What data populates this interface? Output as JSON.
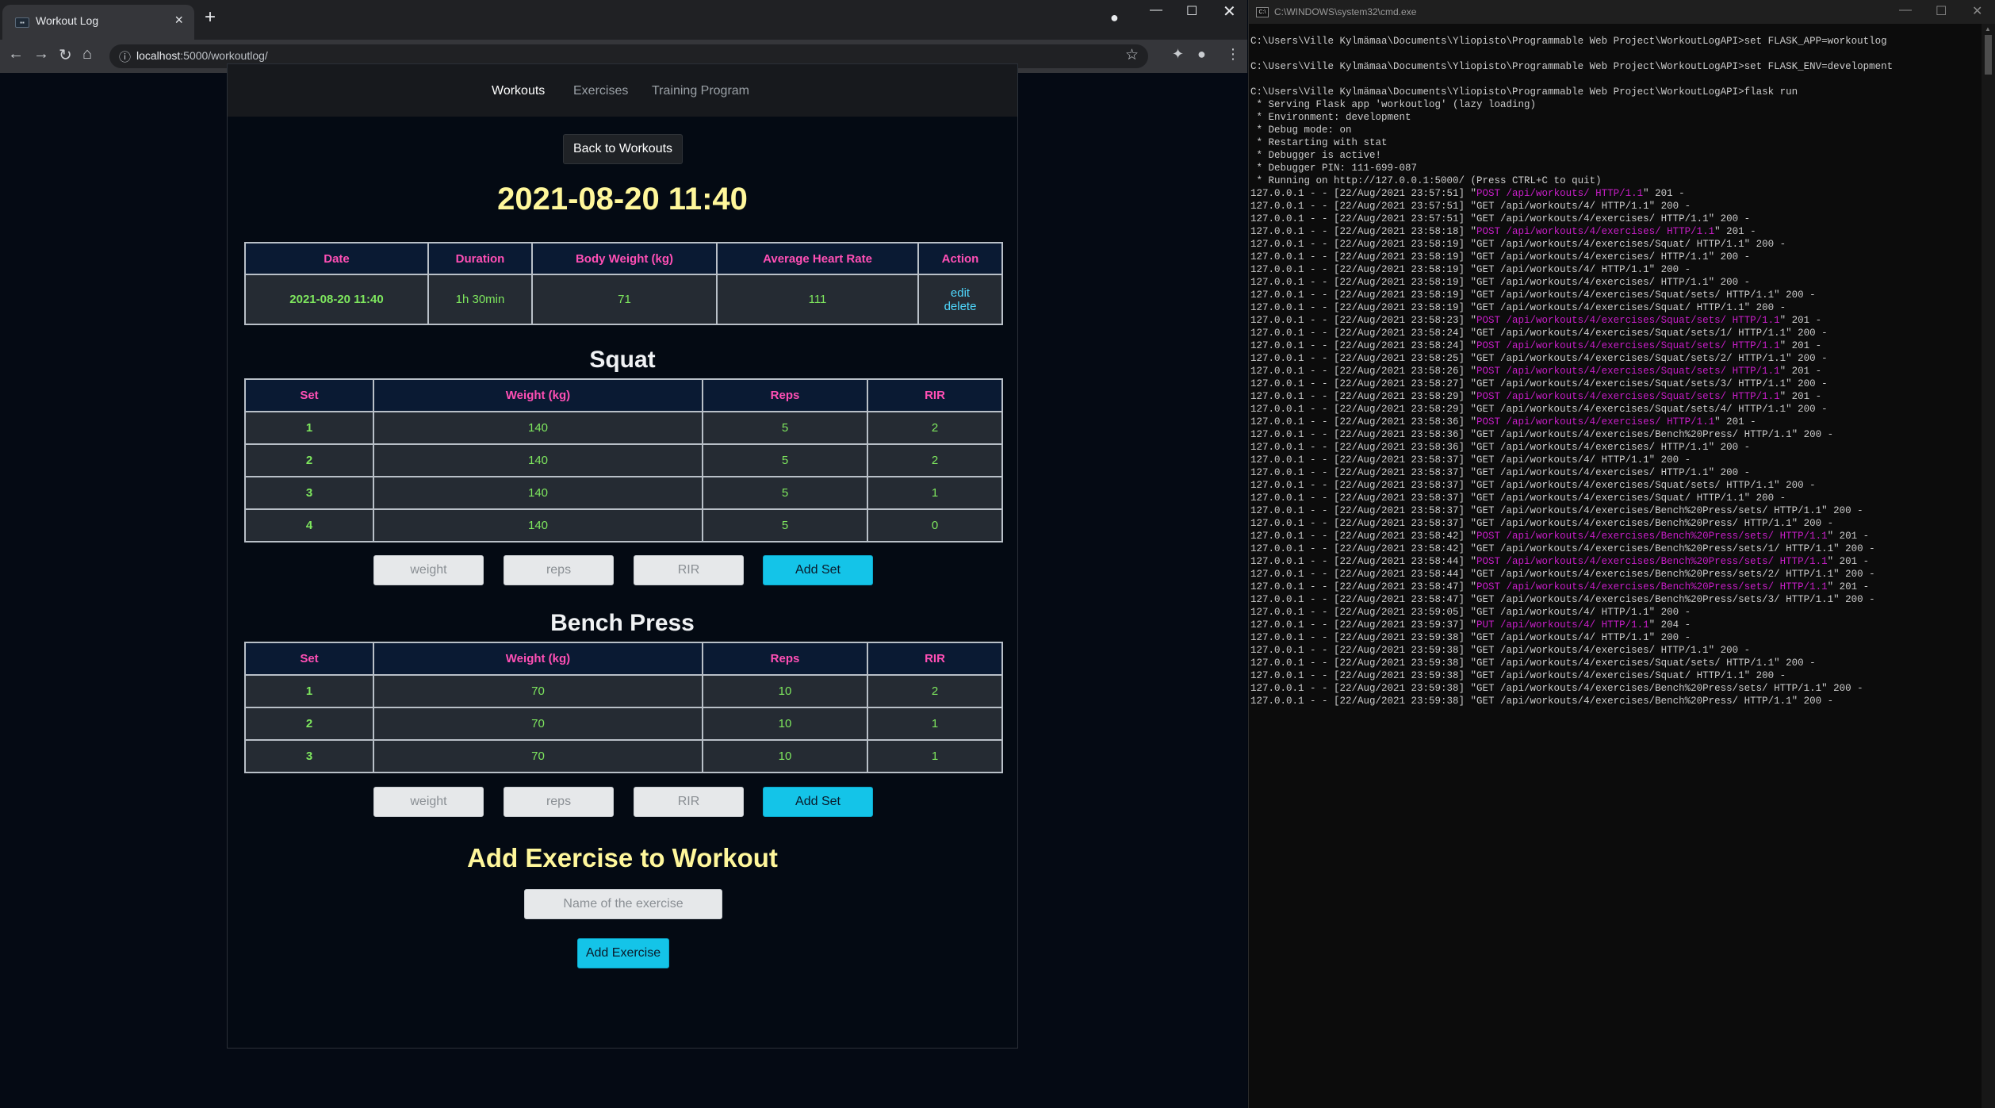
{
  "browser": {
    "tab_title": "Workout Log",
    "url_host": "localhost",
    "url_rest": ":5000/workoutlog/"
  },
  "nav": {
    "workouts": "Workouts",
    "exercises": "Exercises",
    "training_program": "Training Program"
  },
  "back_button": "Back to Workouts",
  "workout": {
    "date_title": "2021-08-20 11:40",
    "headers": [
      "Date",
      "Duration",
      "Body Weight (kg)",
      "Average Heart Rate",
      "Action"
    ],
    "row": [
      "2021-08-20 11:40",
      "1h 30min",
      "71",
      "111"
    ],
    "actions": {
      "edit": "edit",
      "delete": "delete"
    }
  },
  "set_headers": [
    "Set",
    "Weight (kg)",
    "Reps",
    "RIR"
  ],
  "exercises": [
    {
      "name": "Squat",
      "sets": [
        [
          "1",
          "140",
          "5",
          "2"
        ],
        [
          "2",
          "140",
          "5",
          "2"
        ],
        [
          "3",
          "140",
          "5",
          "1"
        ],
        [
          "4",
          "140",
          "5",
          "0"
        ]
      ]
    },
    {
      "name": "Bench Press",
      "sets": [
        [
          "1",
          "70",
          "10",
          "2"
        ],
        [
          "2",
          "70",
          "10",
          "1"
        ],
        [
          "3",
          "70",
          "10",
          "1"
        ]
      ]
    }
  ],
  "set_form": {
    "weight_placeholder": "weight",
    "reps_placeholder": "reps",
    "rir_placeholder": "RIR",
    "add_label": "Add Set"
  },
  "add_exercise": {
    "title": "Add Exercise to Workout",
    "placeholder": "Name of the exercise",
    "button": "Add Exercise"
  },
  "terminal": {
    "title": "C:\\WINDOWS\\system32\\cmd.exe",
    "lines": [
      {
        "t": "C:\\Users\\Ville Kylmämaa\\Documents\\Yliopisto\\Programmable Web Project\\WorkoutLogAPI>set FLASK_APP=workoutlog"
      },
      {
        "t": ""
      },
      {
        "t": "C:\\Users\\Ville Kylmämaa\\Documents\\Yliopisto\\Programmable Web Project\\WorkoutLogAPI>set FLASK_ENV=development"
      },
      {
        "t": ""
      },
      {
        "t": "C:\\Users\\Ville Kylmämaa\\Documents\\Yliopisto\\Programmable Web Project\\WorkoutLogAPI>flask run"
      },
      {
        "t": " * Serving Flask app 'workoutlog' (lazy loading)"
      },
      {
        "t": " * Environment: development"
      },
      {
        "t": " * Debug mode: on"
      },
      {
        "t": " * Restarting with stat"
      },
      {
        "t": " * Debugger is active!"
      },
      {
        "t": " * Debugger PIN: 111-699-087"
      },
      {
        "t": " * Running on http://127.0.0.1:5000/ (Press CTRL+C to quit)"
      },
      {
        "p": "127.0.0.1 - - [22/Aug/2021 23:57:51] \"",
        "h": "POST /api/workouts/ HTTP/1.1",
        "s": "\" 201 -"
      },
      {
        "t": "127.0.0.1 - - [22/Aug/2021 23:57:51] \"GET /api/workouts/4/ HTTP/1.1\" 200 -"
      },
      {
        "t": "127.0.0.1 - - [22/Aug/2021 23:57:51] \"GET /api/workouts/4/exercises/ HTTP/1.1\" 200 -"
      },
      {
        "p": "127.0.0.1 - - [22/Aug/2021 23:58:18] \"",
        "h": "POST /api/workouts/4/exercises/ HTTP/1.1",
        "s": "\" 201 -"
      },
      {
        "t": "127.0.0.1 - - [22/Aug/2021 23:58:19] \"GET /api/workouts/4/exercises/Squat/ HTTP/1.1\" 200 -"
      },
      {
        "t": "127.0.0.1 - - [22/Aug/2021 23:58:19] \"GET /api/workouts/4/exercises/ HTTP/1.1\" 200 -"
      },
      {
        "t": "127.0.0.1 - - [22/Aug/2021 23:58:19] \"GET /api/workouts/4/ HTTP/1.1\" 200 -"
      },
      {
        "t": "127.0.0.1 - - [22/Aug/2021 23:58:19] \"GET /api/workouts/4/exercises/ HTTP/1.1\" 200 -"
      },
      {
        "t": "127.0.0.1 - - [22/Aug/2021 23:58:19] \"GET /api/workouts/4/exercises/Squat/sets/ HTTP/1.1\" 200 -"
      },
      {
        "t": "127.0.0.1 - - [22/Aug/2021 23:58:19] \"GET /api/workouts/4/exercises/Squat/ HTTP/1.1\" 200 -"
      },
      {
        "p": "127.0.0.1 - - [22/Aug/2021 23:58:23] \"",
        "h": "POST /api/workouts/4/exercises/Squat/sets/ HTTP/1.1",
        "s": "\" 201 -"
      },
      {
        "t": "127.0.0.1 - - [22/Aug/2021 23:58:24] \"GET /api/workouts/4/exercises/Squat/sets/1/ HTTP/1.1\" 200 -"
      },
      {
        "p": "127.0.0.1 - - [22/Aug/2021 23:58:24] \"",
        "h": "POST /api/workouts/4/exercises/Squat/sets/ HTTP/1.1",
        "s": "\" 201 -"
      },
      {
        "t": "127.0.0.1 - - [22/Aug/2021 23:58:25] \"GET /api/workouts/4/exercises/Squat/sets/2/ HTTP/1.1\" 200 -"
      },
      {
        "p": "127.0.0.1 - - [22/Aug/2021 23:58:26] \"",
        "h": "POST /api/workouts/4/exercises/Squat/sets/ HTTP/1.1",
        "s": "\" 201 -"
      },
      {
        "t": "127.0.0.1 - - [22/Aug/2021 23:58:27] \"GET /api/workouts/4/exercises/Squat/sets/3/ HTTP/1.1\" 200 -"
      },
      {
        "p": "127.0.0.1 - - [22/Aug/2021 23:58:29] \"",
        "h": "POST /api/workouts/4/exercises/Squat/sets/ HTTP/1.1",
        "s": "\" 201 -"
      },
      {
        "t": "127.0.0.1 - - [22/Aug/2021 23:58:29] \"GET /api/workouts/4/exercises/Squat/sets/4/ HTTP/1.1\" 200 -"
      },
      {
        "p": "127.0.0.1 - - [22/Aug/2021 23:58:36] \"",
        "h": "POST /api/workouts/4/exercises/ HTTP/1.1",
        "s": "\" 201 -"
      },
      {
        "t": "127.0.0.1 - - [22/Aug/2021 23:58:36] \"GET /api/workouts/4/exercises/Bench%20Press/ HTTP/1.1\" 200 -"
      },
      {
        "t": "127.0.0.1 - - [22/Aug/2021 23:58:36] \"GET /api/workouts/4/exercises/ HTTP/1.1\" 200 -"
      },
      {
        "t": "127.0.0.1 - - [22/Aug/2021 23:58:37] \"GET /api/workouts/4/ HTTP/1.1\" 200 -"
      },
      {
        "t": "127.0.0.1 - - [22/Aug/2021 23:58:37] \"GET /api/workouts/4/exercises/ HTTP/1.1\" 200 -"
      },
      {
        "t": "127.0.0.1 - - [22/Aug/2021 23:58:37] \"GET /api/workouts/4/exercises/Squat/sets/ HTTP/1.1\" 200 -"
      },
      {
        "t": "127.0.0.1 - - [22/Aug/2021 23:58:37] \"GET /api/workouts/4/exercises/Squat/ HTTP/1.1\" 200 -"
      },
      {
        "t": "127.0.0.1 - - [22/Aug/2021 23:58:37] \"GET /api/workouts/4/exercises/Bench%20Press/sets/ HTTP/1.1\" 200 -"
      },
      {
        "t": "127.0.0.1 - - [22/Aug/2021 23:58:37] \"GET /api/workouts/4/exercises/Bench%20Press/ HTTP/1.1\" 200 -"
      },
      {
        "p": "127.0.0.1 - - [22/Aug/2021 23:58:42] \"",
        "h": "POST /api/workouts/4/exercises/Bench%20Press/sets/ HTTP/1.1",
        "s": "\" 201 -"
      },
      {
        "t": "127.0.0.1 - - [22/Aug/2021 23:58:42] \"GET /api/workouts/4/exercises/Bench%20Press/sets/1/ HTTP/1.1\" 200 -"
      },
      {
        "p": "127.0.0.1 - - [22/Aug/2021 23:58:44] \"",
        "h": "POST /api/workouts/4/exercises/Bench%20Press/sets/ HTTP/1.1",
        "s": "\" 201 -"
      },
      {
        "t": "127.0.0.1 - - [22/Aug/2021 23:58:44] \"GET /api/workouts/4/exercises/Bench%20Press/sets/2/ HTTP/1.1\" 200 -"
      },
      {
        "p": "127.0.0.1 - - [22/Aug/2021 23:58:47] \"",
        "h": "POST /api/workouts/4/exercises/Bench%20Press/sets/ HTTP/1.1",
        "s": "\" 201 -"
      },
      {
        "t": "127.0.0.1 - - [22/Aug/2021 23:58:47] \"GET /api/workouts/4/exercises/Bench%20Press/sets/3/ HTTP/1.1\" 200 -"
      },
      {
        "t": "127.0.0.1 - - [22/Aug/2021 23:59:05] \"GET /api/workouts/4/ HTTP/1.1\" 200 -"
      },
      {
        "p": "127.0.0.1 - - [22/Aug/2021 23:59:37] \"",
        "h": "PUT /api/workouts/4/ HTTP/1.1",
        "s": "\" 204 -"
      },
      {
        "t": "127.0.0.1 - - [22/Aug/2021 23:59:38] \"GET /api/workouts/4/ HTTP/1.1\" 200 -"
      },
      {
        "t": "127.0.0.1 - - [22/Aug/2021 23:59:38] \"GET /api/workouts/4/exercises/ HTTP/1.1\" 200 -"
      },
      {
        "t": "127.0.0.1 - - [22/Aug/2021 23:59:38] \"GET /api/workouts/4/exercises/Squat/sets/ HTTP/1.1\" 200 -"
      },
      {
        "t": "127.0.0.1 - - [22/Aug/2021 23:59:38] \"GET /api/workouts/4/exercises/Squat/ HTTP/1.1\" 200 -"
      },
      {
        "t": "127.0.0.1 - - [22/Aug/2021 23:59:38] \"GET /api/workouts/4/exercises/Bench%20Press/sets/ HTTP/1.1\" 200 -"
      },
      {
        "t": "127.0.0.1 - - [22/Aug/2021 23:59:38] \"GET /api/workouts/4/exercises/Bench%20Press/ HTTP/1.1\" 200 -"
      }
    ]
  }
}
